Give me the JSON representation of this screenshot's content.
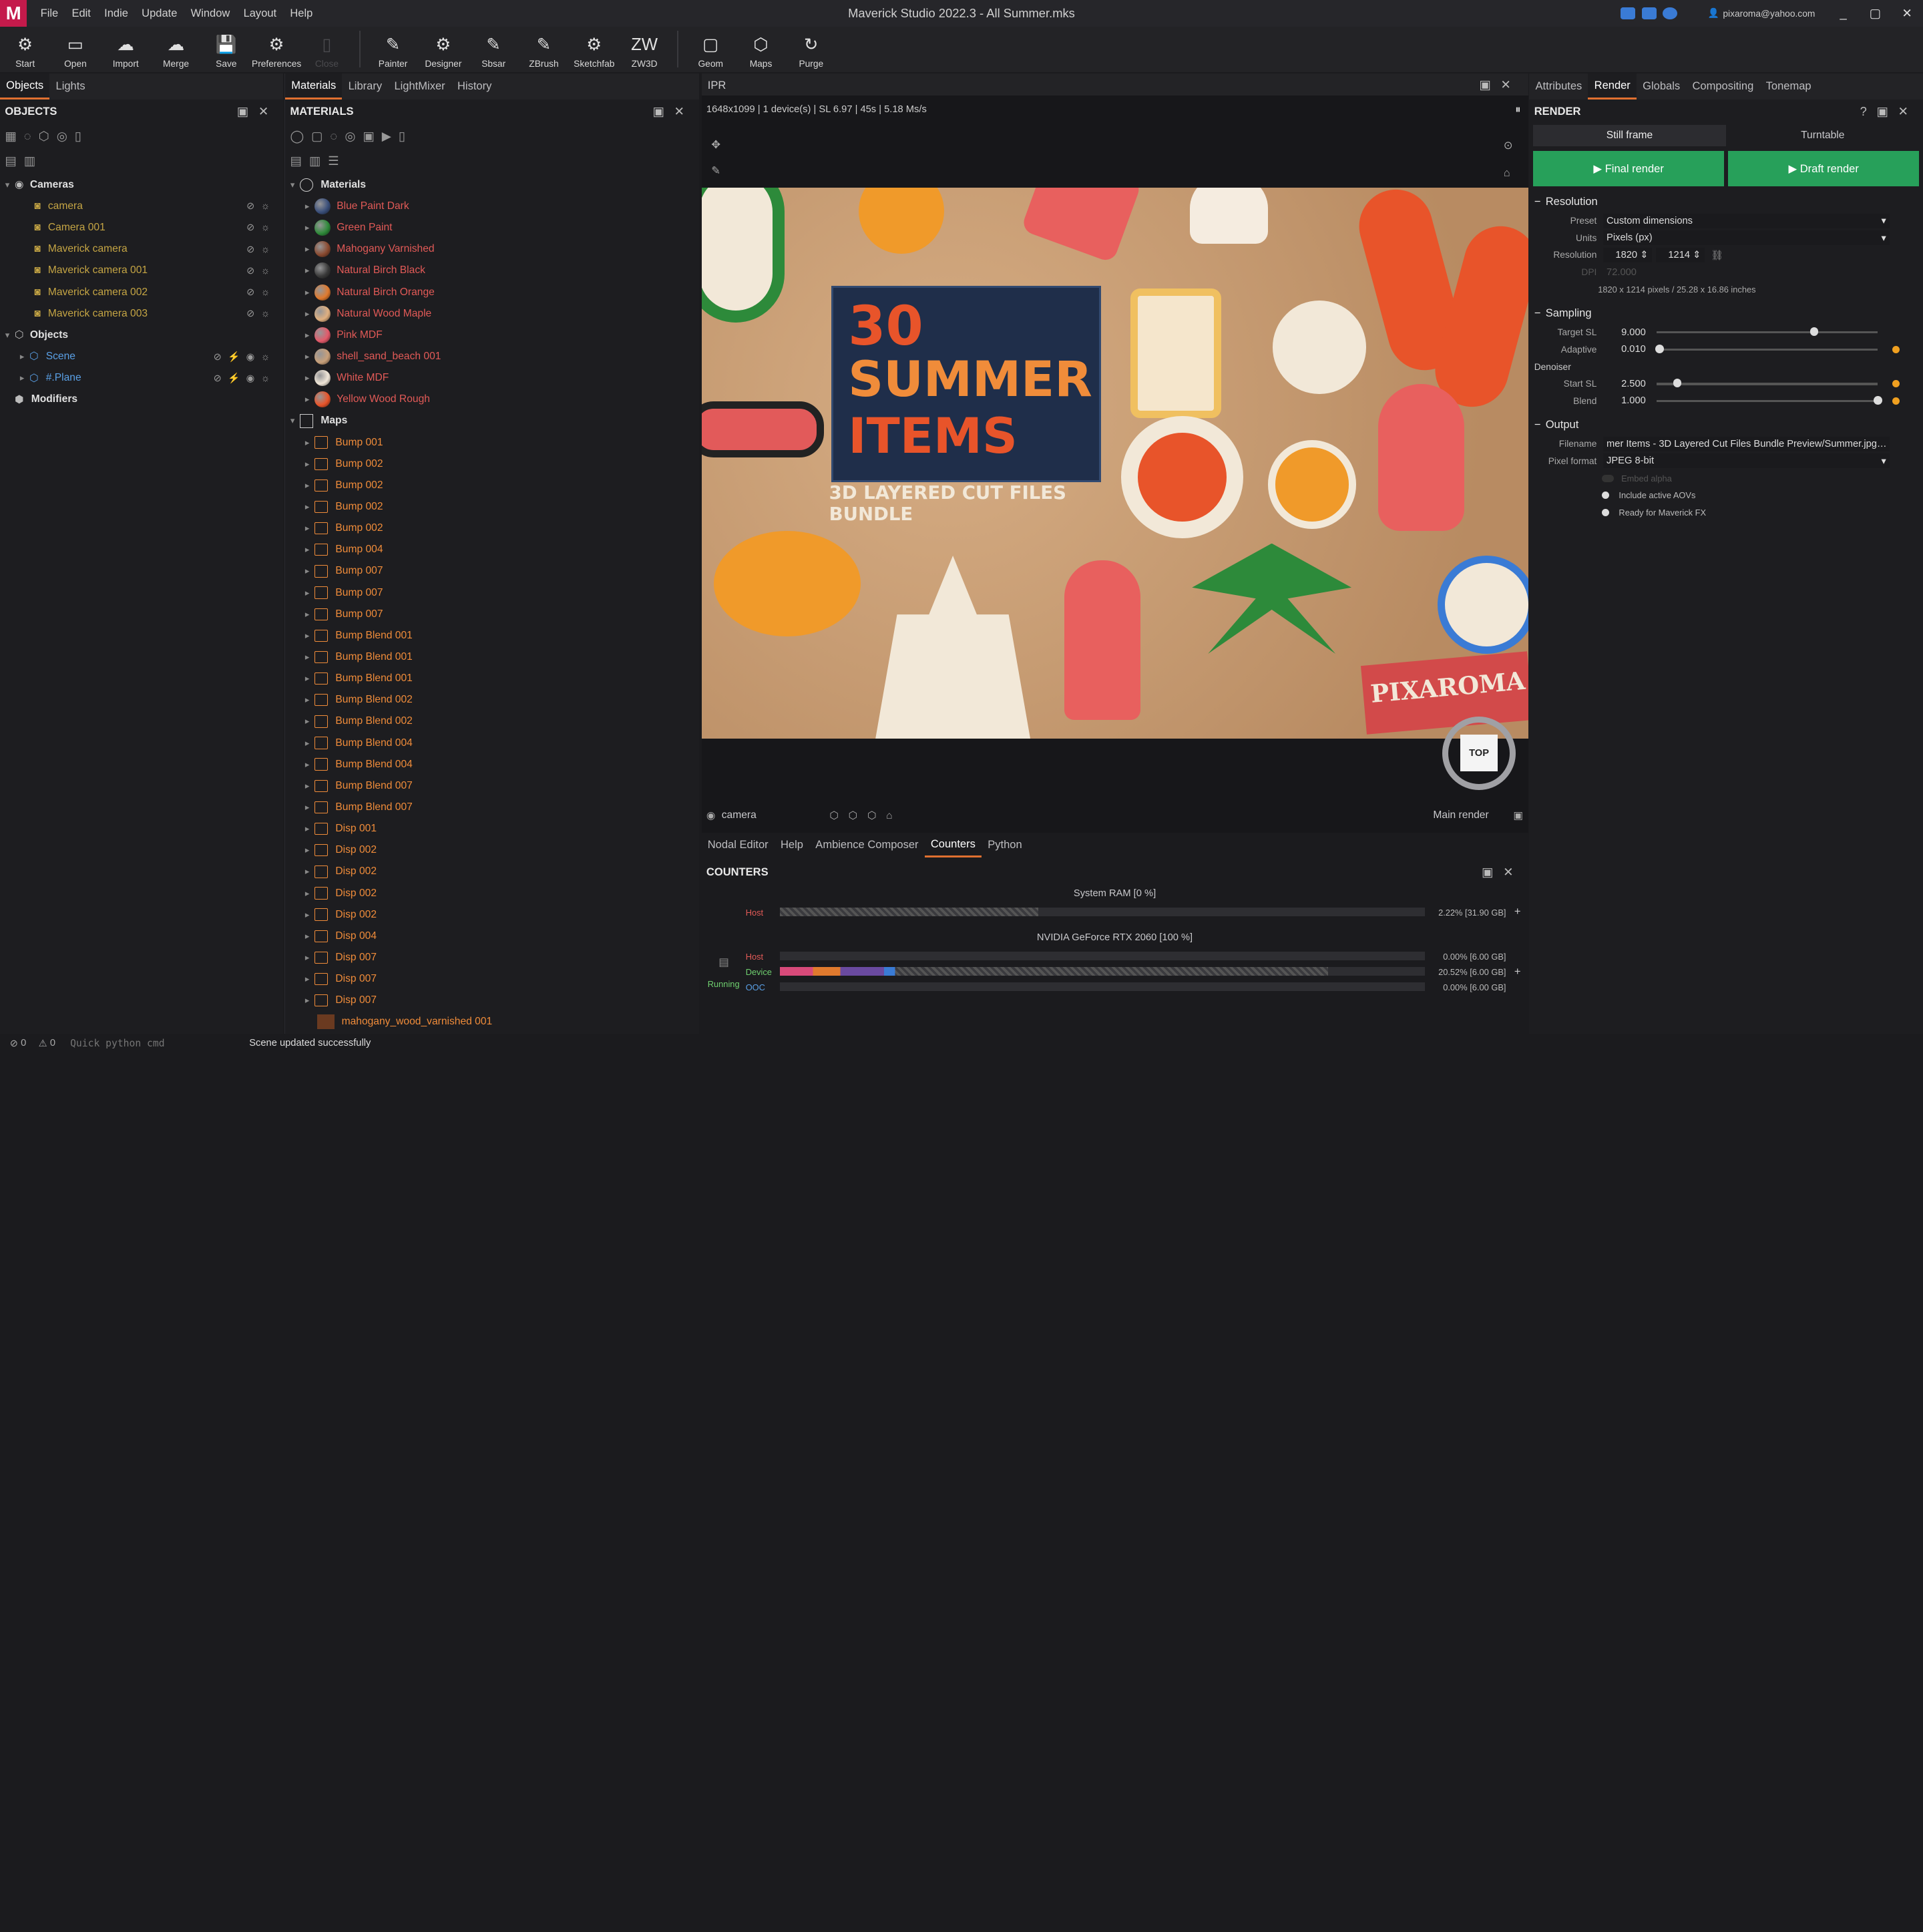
{
  "app": {
    "title": "Maverick Studio 2022.3 - All Summer.mks",
    "logo": "M",
    "user": "pixaroma@yahoo.com"
  },
  "menu": [
    "File",
    "Edit",
    "Indie",
    "Update",
    "Window",
    "Layout",
    "Help"
  ],
  "toolbar": [
    {
      "label": "Start",
      "icon": "⚙"
    },
    {
      "label": "Open",
      "icon": "▭"
    },
    {
      "label": "Import",
      "icon": "☁"
    },
    {
      "label": "Merge",
      "icon": "☁"
    },
    {
      "label": "Save",
      "icon": "💾"
    },
    {
      "label": "Preferences",
      "icon": "⚙"
    },
    {
      "label": "Close",
      "icon": "▯",
      "disabled": true
    },
    {
      "label": "Painter",
      "icon": "✎"
    },
    {
      "label": "Designer",
      "icon": "⚙"
    },
    {
      "label": "Sbsar",
      "icon": "✎"
    },
    {
      "label": "ZBrush",
      "icon": "✎"
    },
    {
      "label": "Sketchfab",
      "icon": "⚙"
    },
    {
      "label": "ZW3D",
      "icon": "ZW"
    },
    {
      "label": "Geom",
      "icon": "▢"
    },
    {
      "label": "Maps",
      "icon": "⬡"
    },
    {
      "label": "Purge",
      "icon": "↻"
    }
  ],
  "left": {
    "tabs": [
      "Objects",
      "Lights"
    ],
    "header": "OBJECTS",
    "cameras_label": "Cameras",
    "cameras": [
      "camera",
      "Camera 001",
      "Maverick camera",
      "Maverick camera 001",
      "Maverick camera 002",
      "Maverick camera 003"
    ],
    "objects_label": "Objects",
    "objects": [
      "Scene",
      "#.Plane"
    ],
    "modifiers_label": "Modifiers"
  },
  "materials": {
    "tabs": [
      "Materials",
      "Library",
      "LightMixer",
      "History"
    ],
    "header": "MATERIALS",
    "group_label": "Materials",
    "items": [
      {
        "name": "Blue Paint Dark",
        "color": "#3a4f7a"
      },
      {
        "name": "Green Paint",
        "color": "#2f8a3a"
      },
      {
        "name": "Mahogany Varnished",
        "color": "#8a4a30"
      },
      {
        "name": "Natural Birch Black",
        "color": "#3a3a3a"
      },
      {
        "name": "Natural Birch Orange",
        "color": "#e07a2e"
      },
      {
        "name": "Natural Wood Maple",
        "color": "#e0b080"
      },
      {
        "name": "Pink MDF",
        "color": "#e35a6a"
      },
      {
        "name": "shell_sand_beach 001",
        "color": "#c8a07a"
      },
      {
        "name": "White MDF",
        "color": "#f0e6d8"
      },
      {
        "name": "Yellow Wood Rough",
        "color": "#e8542a"
      }
    ],
    "maps_label": "Maps",
    "maps": [
      "Bump 001",
      "Bump 002",
      "Bump 002",
      "Bump 002",
      "Bump 002",
      "Bump 004",
      "Bump 007",
      "Bump 007",
      "Bump 007",
      "Bump Blend 001",
      "Bump Blend 001",
      "Bump Blend 001",
      "Bump Blend 002",
      "Bump Blend 002",
      "Bump Blend 004",
      "Bump Blend 004",
      "Bump Blend 007",
      "Bump Blend 007",
      "Disp 001",
      "Disp 002",
      "Disp 002",
      "Disp 002",
      "Disp 002",
      "Disp 004",
      "Disp 007",
      "Disp 007",
      "Disp 007"
    ],
    "last": "mahogany_wood_varnished 001"
  },
  "ipr": {
    "title": "IPR",
    "stats": "1648x1099 | 1 device(s) | SL 6.97 | 45s | 5.18 Ms/s",
    "camera": "camera",
    "render_mode": "Main render",
    "nav_cube": "TOP",
    "poster": {
      "line1": "30",
      "line2": "SUMMER",
      "line3": "ITEMS",
      "sub": "3D LAYERED CUT FILES BUNDLE",
      "brand": "PIXAROMA"
    }
  },
  "bottom": {
    "tabs": [
      "Nodal Editor",
      "Help",
      "Ambience Composer",
      "Counters",
      "Python"
    ],
    "header": "COUNTERS",
    "ram_title": "System RAM [0 %]",
    "ram_host_label": "Host",
    "ram_host_value": "2.22% [31.90 GB]",
    "gpu_title": "NVIDIA GeForce RTX 2060 [100 %]",
    "running": "Running",
    "gpu_rows": [
      {
        "label": "Host",
        "value": "0.00% [6.00 GB]",
        "color": "#e25a57"
      },
      {
        "label": "Device",
        "value": "20.52% [6.00 GB]",
        "color": "#6fcf6f"
      },
      {
        "label": "OOC",
        "value": "0.00% [6.00 GB]",
        "color": "#5aa0e6"
      }
    ]
  },
  "right": {
    "tabs": [
      "Attributes",
      "Render",
      "Globals",
      "Compositing",
      "Tonemap"
    ],
    "header": "RENDER",
    "modes": [
      "Still frame",
      "Turntable"
    ],
    "final": "Final render",
    "draft": "Draft render",
    "resolution": {
      "label": "Resolution",
      "preset_label": "Preset",
      "preset": "Custom dimensions",
      "units_label": "Units",
      "units": "Pixels (px)",
      "res_label": "Resolution",
      "w": "1820",
      "h": "1214",
      "dpi_label": "DPI",
      "dpi": "72.000",
      "info": "1820 x 1214 pixels / 25.28 x 16.86 inches"
    },
    "sampling": {
      "label": "Sampling",
      "target_label": "Target SL",
      "target": "9.000",
      "target_frac": 0.71,
      "adaptive_label": "Adaptive",
      "adaptive": "0.010",
      "adaptive_frac": 0.01,
      "denoiser": "Denoiser",
      "start_label": "Start SL",
      "start": "2.500",
      "start_frac": 0.09,
      "blend_label": "Blend",
      "blend": "1.000",
      "blend_frac": 1.0
    },
    "output": {
      "label": "Output",
      "filename_label": "Filename",
      "filename": "mer Items - 3D Layered Cut Files Bundle Preview/Summer.jpg",
      "pf_label": "Pixel format",
      "pf": "JPEG 8-bit",
      "embed": "Embed alpha",
      "aovs": "Include active AOVs",
      "fx": "Ready for Maverick FX"
    }
  },
  "status": {
    "errors": "0",
    "warnings": "0",
    "python_placeholder": "Quick python cmd",
    "message": "Scene updated successfully"
  }
}
